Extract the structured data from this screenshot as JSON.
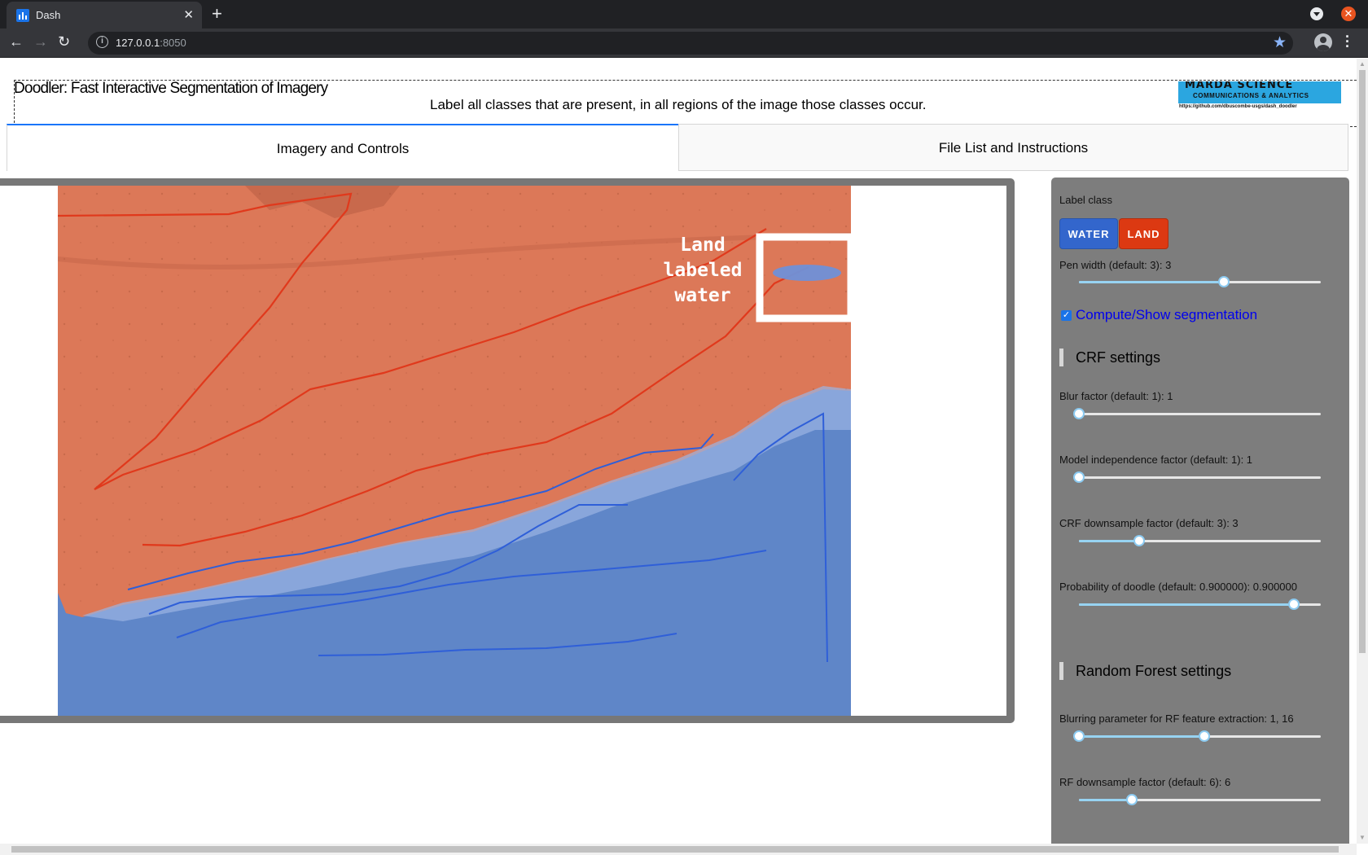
{
  "browser": {
    "tab_title": "Dash",
    "url_host": "127.0.0.1",
    "url_port": ":8050"
  },
  "header": {
    "title": "Doodler: Fast Interactive Segmentation of Imagery",
    "instructions": "Label all classes that are present, in all regions of the image those classes occur.",
    "logo_line1": "MARDA SCIENCE",
    "logo_line2": "COMMUNICATIONS & ANALYTICS",
    "logo_url": "https://github.com/dbuscombe-usgs/dash_doodler"
  },
  "tabs": [
    {
      "label": "Imagery and Controls",
      "active": true
    },
    {
      "label": "File List and Instructions",
      "active": false
    }
  ],
  "image": {
    "annotation": [
      "Land",
      "labeled",
      "water"
    ],
    "colors": {
      "land": "#dc7858",
      "water": "#5f86c8",
      "land_stroke": "#e0391c",
      "water_stroke": "#2f5fd8"
    }
  },
  "controls": {
    "label_class_title": "Label class",
    "classes": [
      {
        "name": "WATER",
        "color": "#3366cc"
      },
      {
        "name": "LAND",
        "color": "#dc3912"
      }
    ],
    "pen_width": {
      "label": "Pen width (default: 3): 3",
      "value": 3,
      "min": 1,
      "max": 5,
      "fraction": 0.6
    },
    "compute_label": "Compute/Show segmentation",
    "compute_checked": true,
    "crf_title": "CRF settings",
    "blur": {
      "label": "Blur factor (default: 1): 1",
      "fraction": 0.0
    },
    "model_indep": {
      "label": "Model independence factor (default: 1): 1",
      "fraction": 0.0
    },
    "crf_downsample": {
      "label": "CRF downsample factor (default: 3): 3",
      "fraction": 0.25
    },
    "prob_doodle": {
      "label": "Probability of doodle (default: 0.900000): 0.900000",
      "fraction": 0.89
    },
    "rf_title": "Random Forest settings",
    "rf_blur": {
      "label": "Blurring parameter for RF feature extraction: 1, 16",
      "range_fraction": [
        0.0,
        0.52
      ]
    },
    "rf_downsample": {
      "label": "RF downsample factor (default: 6): 6",
      "fraction": 0.22
    }
  }
}
